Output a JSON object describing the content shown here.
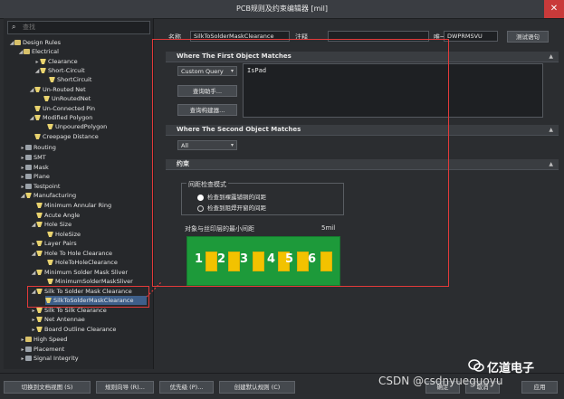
{
  "window": {
    "title": "PCB规则及约束编辑器 [mil]"
  },
  "search": {
    "placeholder": "查找"
  },
  "tree": [
    {
      "label": "Design Rules",
      "icon": "folder"
    },
    {
      "label": "Electrical",
      "icon": "folder"
    },
    {
      "label": "Clearance",
      "icon": "rule"
    },
    {
      "label": "Short-Circuit",
      "icon": "rule"
    },
    {
      "label": "ShortCircuit",
      "icon": "rule"
    },
    {
      "label": "Un-Routed Net",
      "icon": "rule"
    },
    {
      "label": "UnRoutedNet",
      "icon": "rule"
    },
    {
      "label": "Un-Connected Pin",
      "icon": "rule"
    },
    {
      "label": "Modified Polygon",
      "icon": "rule"
    },
    {
      "label": "UnpouredPolygon",
      "icon": "rule"
    },
    {
      "label": "Creepage Distance",
      "icon": "rule"
    },
    {
      "label": "Routing",
      "icon": "grey"
    },
    {
      "label": "SMT",
      "icon": "grey"
    },
    {
      "label": "Mask",
      "icon": "grey"
    },
    {
      "label": "Plane",
      "icon": "grey"
    },
    {
      "label": "Testpoint",
      "icon": "grey"
    },
    {
      "label": "Manufacturing",
      "icon": "rule"
    },
    {
      "label": "Minimum Annular Ring",
      "icon": "rule"
    },
    {
      "label": "Acute Angle",
      "icon": "rule"
    },
    {
      "label": "Hole Size",
      "icon": "rule"
    },
    {
      "label": "HoleSize",
      "icon": "rule"
    },
    {
      "label": "Layer Pairs",
      "icon": "rule"
    },
    {
      "label": "Hole To Hole Clearance",
      "icon": "rule"
    },
    {
      "label": "HoleToHoleClearance",
      "icon": "rule"
    },
    {
      "label": "Minimum Solder Mask Sliver",
      "icon": "rule"
    },
    {
      "label": "MinimumSolderMaskSliver",
      "icon": "rule"
    },
    {
      "label": "Silk To Solder Mask Clearance",
      "icon": "rule"
    },
    {
      "label": "SilkToSolderMaskClearance",
      "icon": "rule"
    },
    {
      "label": "Silk To Silk Clearance",
      "icon": "rule"
    },
    {
      "label": "Net Antennae",
      "icon": "rule"
    },
    {
      "label": "Board Outline Clearance",
      "icon": "rule"
    },
    {
      "label": "High Speed",
      "icon": "grey"
    },
    {
      "label": "Placement",
      "icon": "grey"
    },
    {
      "label": "Signal Integrity",
      "icon": "grey"
    }
  ],
  "rule": {
    "name_label": "名称",
    "name_value": "SilkToSolderMaskClearance",
    "comment_label": "注释",
    "comment_value": "",
    "uid_label": "唯一ID",
    "uid_value": "DWPRMSVU",
    "test_button": "测试语句"
  },
  "first_match": {
    "header": "Where The First Object Matches",
    "query_type": "Custom Query",
    "query_helper_button": "查询助手...",
    "query_builder_button": "查询构建器...",
    "query_text": "IsPad"
  },
  "second_match": {
    "header": "Where The Second Object Matches",
    "query_type": "All"
  },
  "constraints": {
    "header": "约束",
    "mode_title": "间距检查模式",
    "option_1": "检查到裸露铺铜的间距",
    "option_2": "检查到阻焊开窗的间距",
    "min_clearance_label": "对象与丝印层的最小间距",
    "min_clearance_value": "5mil",
    "pads": [
      "1",
      "2",
      "3",
      "4",
      "5",
      "6"
    ]
  },
  "bottom": {
    "buttons": [
      "切换到文档视图 (S)",
      "规则向导 (R)...",
      "优先级 (P)...",
      "创建默认规则 (C)"
    ],
    "ok": "确定",
    "cancel": "取消",
    "apply": "应用"
  },
  "watermark": {
    "csdn": "CSDN @csdnyueguoyu",
    "brand": "亿道电子"
  },
  "colors": {
    "accent_red": "#e23a3a",
    "board_green": "#1d9a3a",
    "pad_yellow": "#f2c200",
    "selected_row": "#3e5f8a"
  }
}
